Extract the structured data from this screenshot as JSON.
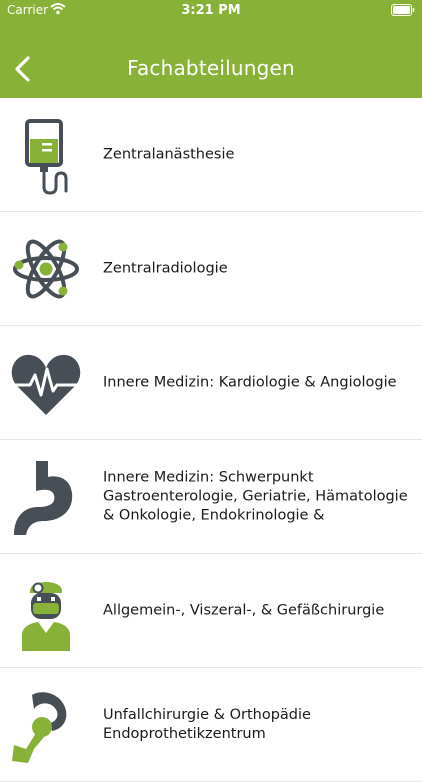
{
  "status_bar": {
    "carrier": "Carrier",
    "time": "3:21 PM"
  },
  "nav": {
    "title": "Fachabteilungen",
    "back_icon": "chevron-left-icon"
  },
  "colors": {
    "accent": "#88b138",
    "icon_dark": "#474e55",
    "divider": "#e6e6e6"
  },
  "departments": [
    {
      "label": "Zentralanästhesie",
      "icon": "iv-drip-icon"
    },
    {
      "label": "Zentralradiologie",
      "icon": "atom-icon"
    },
    {
      "label": "Innere Medizin: Kardiologie & Angiologie",
      "icon": "heart-pulse-icon"
    },
    {
      "label": "Innere Medizin: Schwerpunkt Gastroenterologie, Geriatrie, Hämatologie & Onkologie, Endokrinologie &",
      "icon": "stomach-icon"
    },
    {
      "label": "Allgemein-, Viszeral-, & Gefäßchirurgie",
      "icon": "surgeon-icon"
    },
    {
      "label": "Unfallchirurgie & Orthopädie Endoprothetikzentrum",
      "icon": "hip-joint-icon"
    }
  ]
}
